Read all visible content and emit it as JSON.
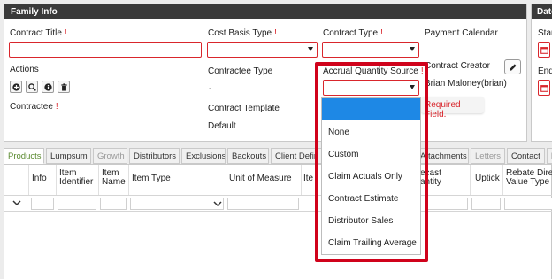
{
  "family_info": {
    "title": "Family Info",
    "contract_title_label": "Contract Title",
    "cost_basis_type_label": "Cost Basis Type",
    "contract_type_label": "Contract Type",
    "payment_calendar_label": "Payment Calendar",
    "actions_label": "Actions",
    "contractee_type_label": "Contractee Type",
    "contractee_type_value": "-",
    "accrual_quantity_source_label": "Accrual Quantity Source",
    "contract_creator_label": "Contract Creator",
    "contract_creator_value": "Brian Maloney(brian)",
    "contractee_label": "Contractee",
    "contract_template_label": "Contract Template",
    "contract_template_value": "Default",
    "required_marker": "!",
    "required_tooltip": "Required Field."
  },
  "dates_panel": {
    "title": "Date",
    "start_label": "Star",
    "end_label": "End"
  },
  "action_icons": [
    "plus-icon",
    "search-icon",
    "info-icon",
    "trash-icon"
  ],
  "tabs": [
    {
      "label": "Products",
      "state": "active"
    },
    {
      "label": "Lumpsum",
      "state": "normal"
    },
    {
      "label": "Growth",
      "state": "disabled"
    },
    {
      "label": "Distributors",
      "state": "normal"
    },
    {
      "label": "Exclusions",
      "state": "normal"
    },
    {
      "label": "Backouts",
      "state": "normal"
    },
    {
      "label": "Client Defin",
      "state": "normal"
    },
    {
      "label": "Attachments",
      "state": "normal"
    },
    {
      "label": "Letters",
      "state": "disabled"
    },
    {
      "label": "Contact",
      "state": "normal"
    },
    {
      "label": "E",
      "state": "normal"
    }
  ],
  "grid": {
    "columns": [
      "Info",
      "Item Identifier",
      "Item Name",
      "Item Type",
      "Unit of Measure",
      "Ite",
      "ecast antity",
      "Uptick",
      "Rebate Direc Value Type"
    ]
  },
  "dropdown": {
    "options": [
      "",
      "None",
      "Custom",
      "Claim Actuals Only",
      "Contract Estimate",
      "Distributor Sales",
      "Claim Trailing Average"
    ],
    "highlighted_index": 0
  },
  "colors": {
    "header_bg": "#3a3a3a",
    "required_red": "#d9262c",
    "active_tab_green": "#5a8a2f",
    "selection_blue": "#1e88e5",
    "highlight_red": "#d0021b"
  }
}
